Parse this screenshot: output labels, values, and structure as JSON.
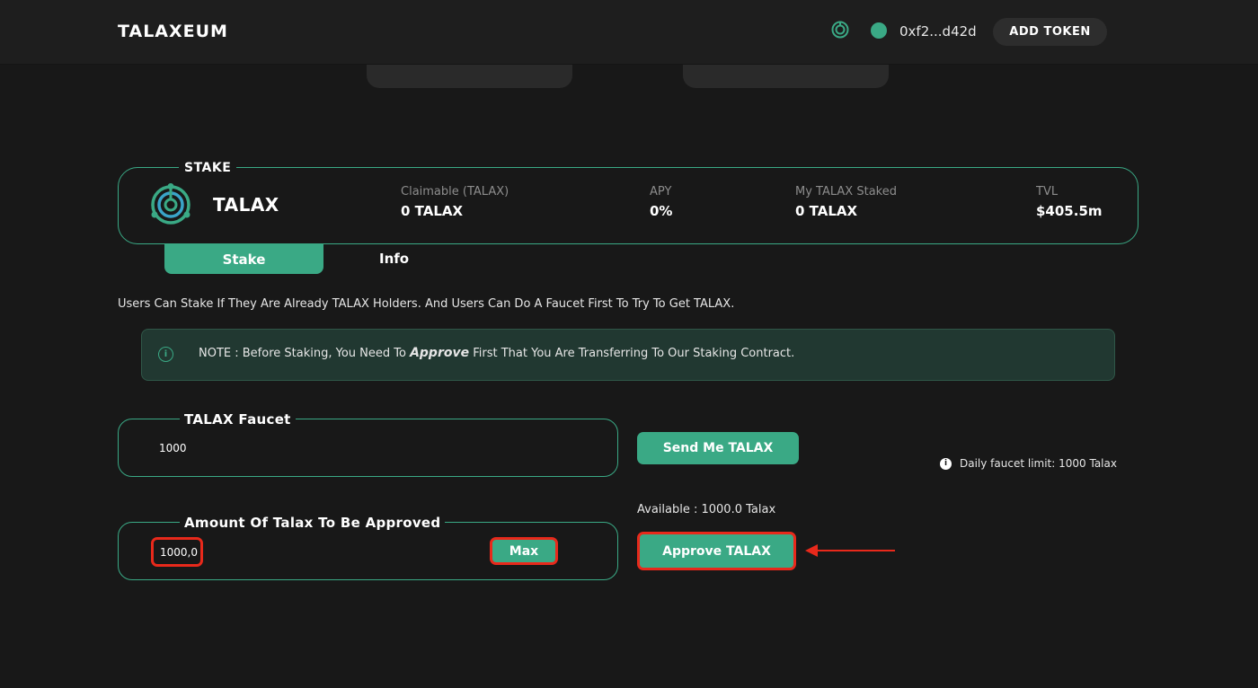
{
  "header": {
    "brand": "TALAXEUM",
    "wallet_address": "0xf2...d42d",
    "add_token_label": "ADD TOKEN"
  },
  "stake_card": {
    "legend": "STAKE",
    "token_name": "TALAX",
    "stats": [
      {
        "label": "Claimable (TALAX)",
        "value": "0 TALAX"
      },
      {
        "label": "APY",
        "value": "0%"
      },
      {
        "label": "My TALAX Staked",
        "value": "0 TALAX"
      },
      {
        "label": "TVL",
        "value": "$405.5m"
      }
    ]
  },
  "tabs": [
    {
      "label": "Stake",
      "active": true
    },
    {
      "label": "Info",
      "active": false
    }
  ],
  "description": "Users Can Stake If They Are Already TALAX Holders. And Users Can Do A Faucet First To Try To Get TALAX.",
  "note": {
    "icon": "info-icon",
    "prefix": "NOTE : Before Staking, You Need To ",
    "emphasis": "Approve",
    "suffix": " First That You Are Transferring To Our Staking Contract."
  },
  "faucet": {
    "legend": "TALAX Faucet",
    "value": "1000",
    "button_label": "Send Me TALAX",
    "limit_text": "Daily faucet limit: 1000 Talax"
  },
  "approve": {
    "legend": "Amount Of Talax To Be Approved",
    "value": "1000,0",
    "max_label": "Max",
    "available_text": "Available : 1000.0 Talax",
    "button_label": "Approve TALAX"
  },
  "colors": {
    "accent": "#3aa985",
    "highlight": "#e8291b",
    "background": "#181818",
    "note_background": "#213831"
  }
}
